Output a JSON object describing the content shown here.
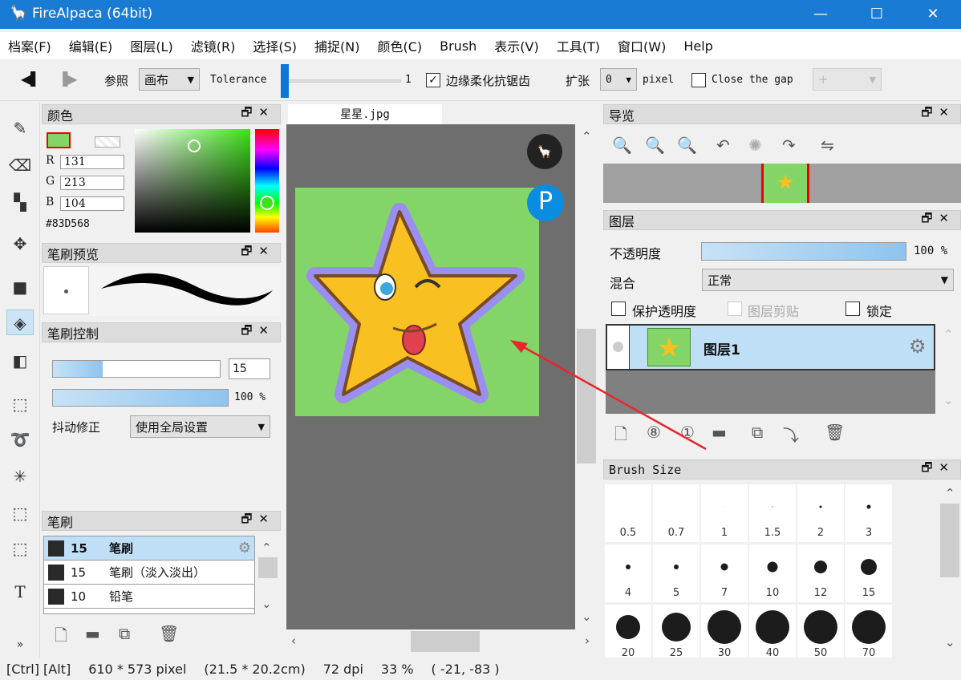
{
  "window": {
    "title": "FireAlpaca (64bit)",
    "min": "—",
    "max": "☐",
    "close": "✕"
  },
  "menu": [
    "档案(F)",
    "编辑(E)",
    "图层(L)",
    "滤镜(R)",
    "选择(S)",
    "捕捉(N)",
    "颜色(C)",
    "Brush",
    "表示(V)",
    "工具(T)",
    "窗口(W)",
    "Help"
  ],
  "toolbar": {
    "ref_label": "参照",
    "ref_value": "画布",
    "tolerance_label": "Tolerance",
    "tolerance_value": "1",
    "tolerance_fraction": 0.01,
    "antialias_label": "边缘柔化抗锯齿",
    "antialias_checked": true,
    "expand_label": "扩张",
    "expand_value": "0",
    "pixel_label": "pixel",
    "close_gap_label": "Close the gap",
    "close_gap_checked": false,
    "gap_value": "+"
  },
  "color_panel": {
    "title": "颜色",
    "r_label": "R",
    "r": "131",
    "g_label": "G",
    "g": "213",
    "b_label": "B",
    "b": "104",
    "hex": "#83D568",
    "current_color": "#83d568"
  },
  "brush_preview": {
    "title": "笔刷预览"
  },
  "brush_control": {
    "title": "笔刷控制",
    "size": "15",
    "size_fraction": 0.25,
    "opacity": "100 %",
    "opacity_fraction": 1.0,
    "stabilizer_label": "抖动修正",
    "stabilizer_value": "使用全局设置"
  },
  "brush_panel": {
    "title": "笔刷",
    "items": [
      {
        "size": "15",
        "name": "笔刷",
        "selected": true
      },
      {
        "size": "15",
        "name": "笔刷（淡入淡出）"
      },
      {
        "size": "10",
        "name": "铅笔"
      }
    ]
  },
  "canvas": {
    "tab": "星星.jpg",
    "bg_color": "#83d568"
  },
  "navigator": {
    "title": "导览"
  },
  "layers": {
    "title": "图层",
    "opacity_label": "不透明度",
    "opacity": "100 %",
    "opacity_fraction": 1.0,
    "blend_label": "混合",
    "blend_value": "正常",
    "protect_alpha": "保护透明度",
    "clipping": "图层剪贴",
    "lock": "锁定",
    "items": [
      {
        "name": "图层1"
      }
    ]
  },
  "brush_size": {
    "title": "Brush Size",
    "sizes": [
      "0.5",
      "0.7",
      "1",
      "1.5",
      "2",
      "3",
      "4",
      "5",
      "7",
      "10",
      "12",
      "15",
      "20",
      "25",
      "30",
      "40",
      "50",
      "70"
    ]
  },
  "status": {
    "keys": "[Ctrl] [Alt]",
    "pixels": "610 * 573 pixel",
    "cm": "(21.5 * 20.2cm)",
    "dpi": "72 dpi",
    "zoom": "33 %",
    "coords": "( -21, -83 )"
  }
}
